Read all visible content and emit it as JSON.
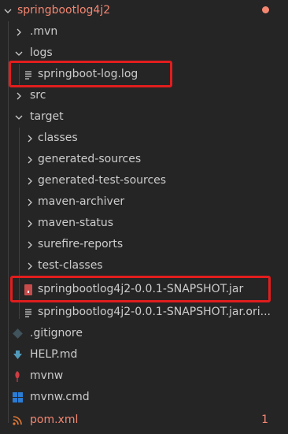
{
  "explorer": {
    "root": {
      "label": "springbootlog4j2",
      "git_dot_color": "#f48771"
    },
    "items": [
      {
        "label": ".mvn",
        "kind": "folder",
        "state": "collapsed"
      },
      {
        "label": "logs",
        "kind": "folder",
        "state": "expanded"
      },
      {
        "label": "springboot-log.log",
        "kind": "file",
        "icon": "text-file-icon"
      },
      {
        "label": "src",
        "kind": "folder",
        "state": "collapsed"
      },
      {
        "label": "target",
        "kind": "folder",
        "state": "expanded"
      },
      {
        "label": "classes",
        "kind": "folder",
        "state": "collapsed"
      },
      {
        "label": "generated-sources",
        "kind": "folder",
        "state": "collapsed"
      },
      {
        "label": "generated-test-sources",
        "kind": "folder",
        "state": "collapsed"
      },
      {
        "label": "maven-archiver",
        "kind": "folder",
        "state": "collapsed"
      },
      {
        "label": "maven-status",
        "kind": "folder",
        "state": "collapsed"
      },
      {
        "label": "surefire-reports",
        "kind": "folder",
        "state": "collapsed"
      },
      {
        "label": "test-classes",
        "kind": "folder",
        "state": "collapsed"
      },
      {
        "label": "springbootlog4j2-0.0.1-SNAPSHOT.jar",
        "kind": "file",
        "icon": "jar-file-icon"
      },
      {
        "label": "springbootlog4j2-0.0.1-SNAPSHOT.jar.ori...",
        "kind": "file",
        "icon": "text-file-icon"
      },
      {
        "label": ".gitignore",
        "kind": "file",
        "icon": "git-icon"
      },
      {
        "label": "HELP.md",
        "kind": "file",
        "icon": "markdown-icon"
      },
      {
        "label": "mvnw",
        "kind": "file",
        "icon": "feather-icon"
      },
      {
        "label": "mvnw.cmd",
        "kind": "file",
        "icon": "windows-icon"
      },
      {
        "label": "pom.xml",
        "kind": "file",
        "icon": "rss-icon",
        "badge": "1"
      }
    ]
  },
  "colors": {
    "background": "#252526",
    "text": "#cccccc",
    "git_modified": "#f48771",
    "highlight_border": "#e11d1d",
    "jar_icon": "#c74b4b",
    "markdown_icon": "#519aba",
    "git_icon": "#41535b",
    "feather_icon": "#cc3e44",
    "windows_icon": "#2b7cd3",
    "rss_icon": "#e37933"
  }
}
